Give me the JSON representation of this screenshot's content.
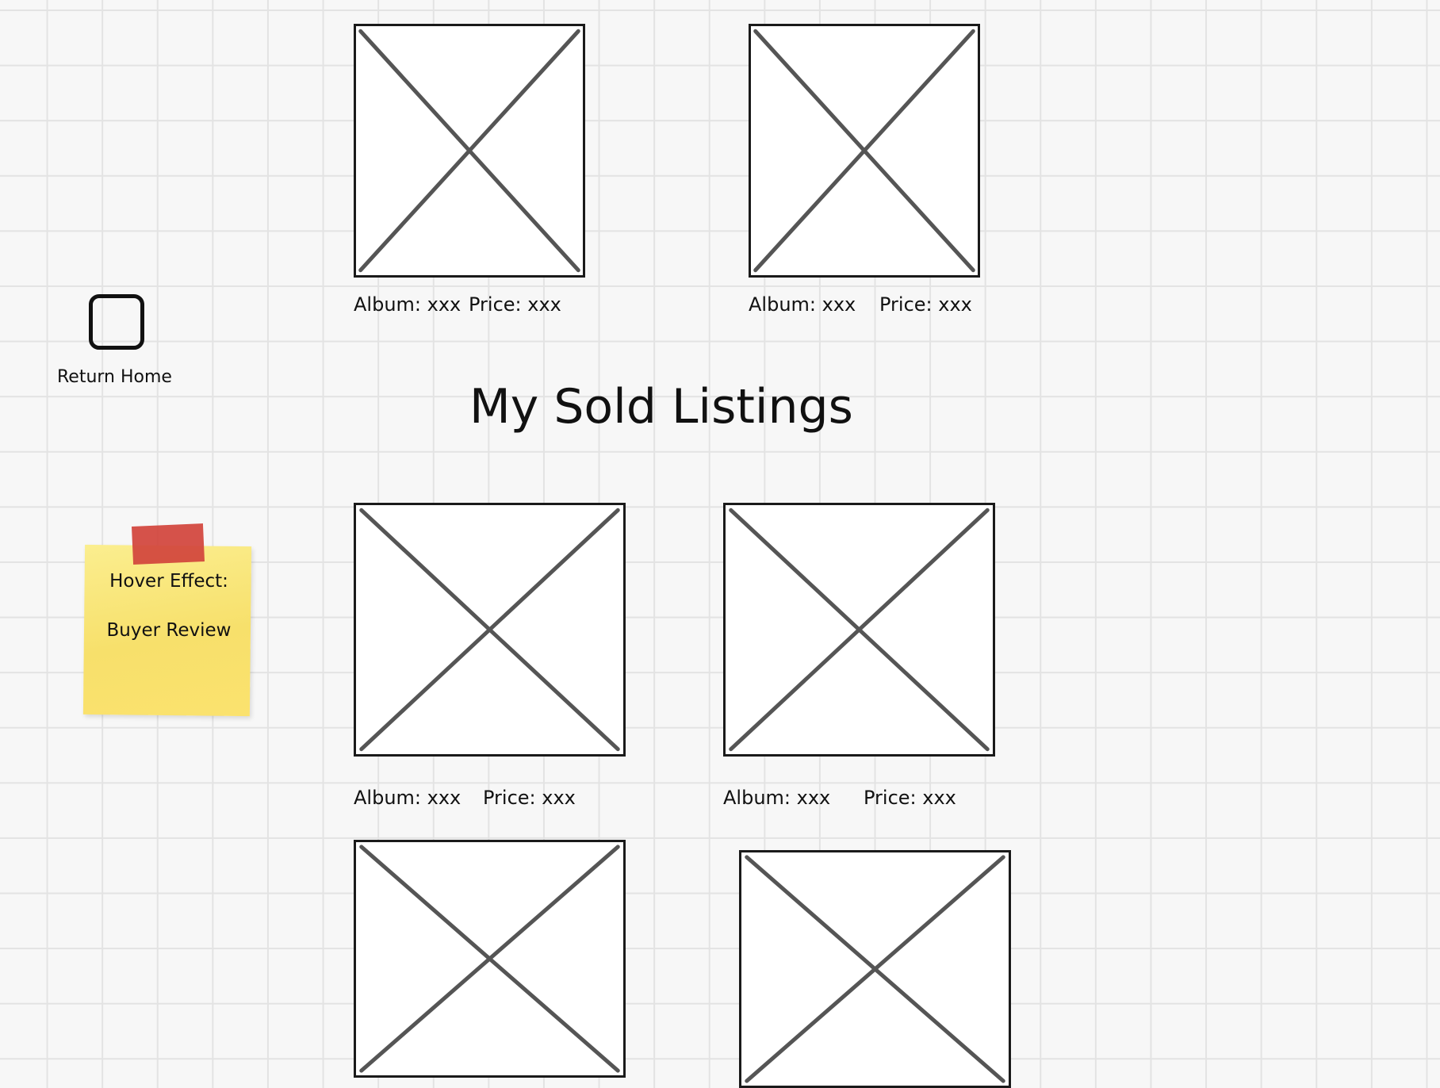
{
  "sidebar": {
    "return_home_label": "Return Home"
  },
  "main": {
    "section_title": "My Sold Listings",
    "top_listings": [
      {
        "album": "Album: xxx",
        "price": "Price: xxx"
      },
      {
        "album": "Album: xxx",
        "price": "Price: xxx"
      }
    ],
    "sold_listings": [
      {
        "album": "Album: xxx",
        "price": "Price: xxx"
      },
      {
        "album": "Album: xxx",
        "price": "Price: xxx"
      },
      {
        "album": "",
        "price": ""
      },
      {
        "album": "",
        "price": ""
      }
    ]
  },
  "sticky_note": {
    "line1": "Hover Effect:",
    "line2": "Buyer Review"
  }
}
